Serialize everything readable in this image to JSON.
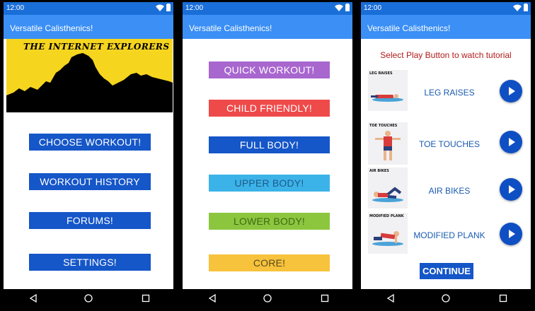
{
  "status_time": "12:00",
  "app_title": "Versatile Calisthenics!",
  "screen1": {
    "banner_title": "THE INTERNET EXPLORERS",
    "buttons": [
      "CHOOSE WORKOUT!",
      "WORKOUT HISTORY",
      "FORUMS!",
      "SETTINGS!"
    ]
  },
  "screen2": {
    "buttons": [
      {
        "label": "QUICK WORKOUT!",
        "color": "#a866cf",
        "text_color": "#ffffff"
      },
      {
        "label": "CHILD FRIENDLY!",
        "color": "#ef4a4a",
        "text_color": "#ffffff"
      },
      {
        "label": "FULL BODY!",
        "color": "#1556c8",
        "text_color": "#ffffff"
      },
      {
        "label": "UPPER BODY!",
        "color": "#3cb3e8",
        "text_color": "#1d5a8a"
      },
      {
        "label": "LOWER BODY!",
        "color": "#8cc63f",
        "text_color": "#3c6a12"
      },
      {
        "label": "CORE!",
        "color": "#f7c23c",
        "text_color": "#5a4a20"
      }
    ]
  },
  "screen3": {
    "instruction": "Select Play Button to watch tutorial",
    "exercises": [
      {
        "caption": "LEG RAISES",
        "label": "LEG RAISES"
      },
      {
        "caption": "TOE TOUCHES",
        "label": "TOE TOUCHES"
      },
      {
        "caption": "AIR BIKES",
        "label": "AIR BIKES"
      },
      {
        "caption": "MODIFIED PLANK",
        "label": "MODIFIED PLANK"
      }
    ],
    "continue_label": "CONTINUE"
  },
  "icons": {
    "play": "play-icon",
    "back": "back-icon",
    "home": "home-icon",
    "recents": "recents-icon",
    "wifi": "wifi-icon",
    "battery": "battery-icon"
  }
}
